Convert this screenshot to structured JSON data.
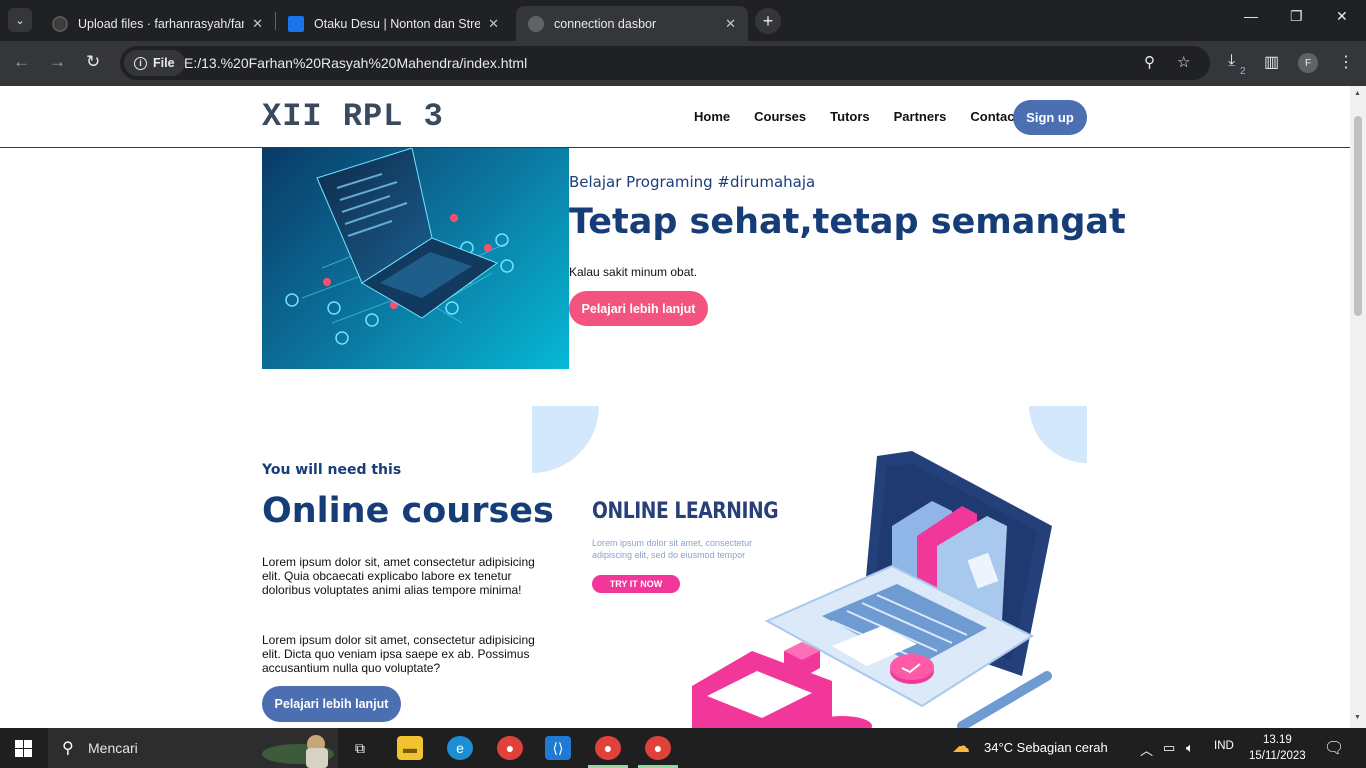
{
  "browser": {
    "tabs": [
      {
        "title": "Upload files · farhanrasyah/farha",
        "icon": "github-icon",
        "active": false
      },
      {
        "title": "Otaku Desu | Nonton dan Stream",
        "icon": "site-icon",
        "active": false
      },
      {
        "title": "connection dasbor",
        "icon": "globe-icon",
        "active": true
      }
    ],
    "chip_label": "File",
    "url": "E:/13.%20Farhan%20Rasyah%20Mahendra/index.html",
    "profile_initial": "F",
    "download_badge": "2"
  },
  "site": {
    "logo": "XII RPL 3",
    "nav": [
      "Home",
      "Courses",
      "Tutors",
      "Partners",
      "Contact"
    ],
    "signup": "Sign up"
  },
  "hero": {
    "subtitle": "Belajar Programing #dirumahaja",
    "title": "Tetap sehat,tetap semangat",
    "text": "Kalau sakit minum obat.",
    "button": "Pelajari lebih lanjut"
  },
  "courses": {
    "subtitle": "You will need this",
    "title": "Online courses",
    "paragraphs": [
      "Lorem ipsum dolor sit, amet consectetur adipisicing elit. Quia obcaecati explicabo labore ex tenetur doloribus voluptates animi alias tempore minima!",
      "Lorem ipsum dolor sit amet, consectetur adipisicing elit. Dicta quo veniam ipsa saepe ex ab. Possimus accusantium nulla quo voluptate?"
    ],
    "button": "Pelajari lebih lanjut",
    "illustration": {
      "heading": "ONLINE LEARNING",
      "lorem": "Lorem ipsum dolor sit amet, consectetur adipiscing elit, sed do eiusmod tempor",
      "cta": "TRY IT NOW"
    }
  },
  "taskbar": {
    "search_placeholder": "Mencari",
    "weather": "34°C  Sebagian cerah",
    "language": "IND",
    "time": "13.19",
    "date": "15/11/2023"
  },
  "colors": {
    "brand_blue": "#4b6fb0",
    "heading_blue": "#163d78",
    "pink": "#f2547f"
  }
}
